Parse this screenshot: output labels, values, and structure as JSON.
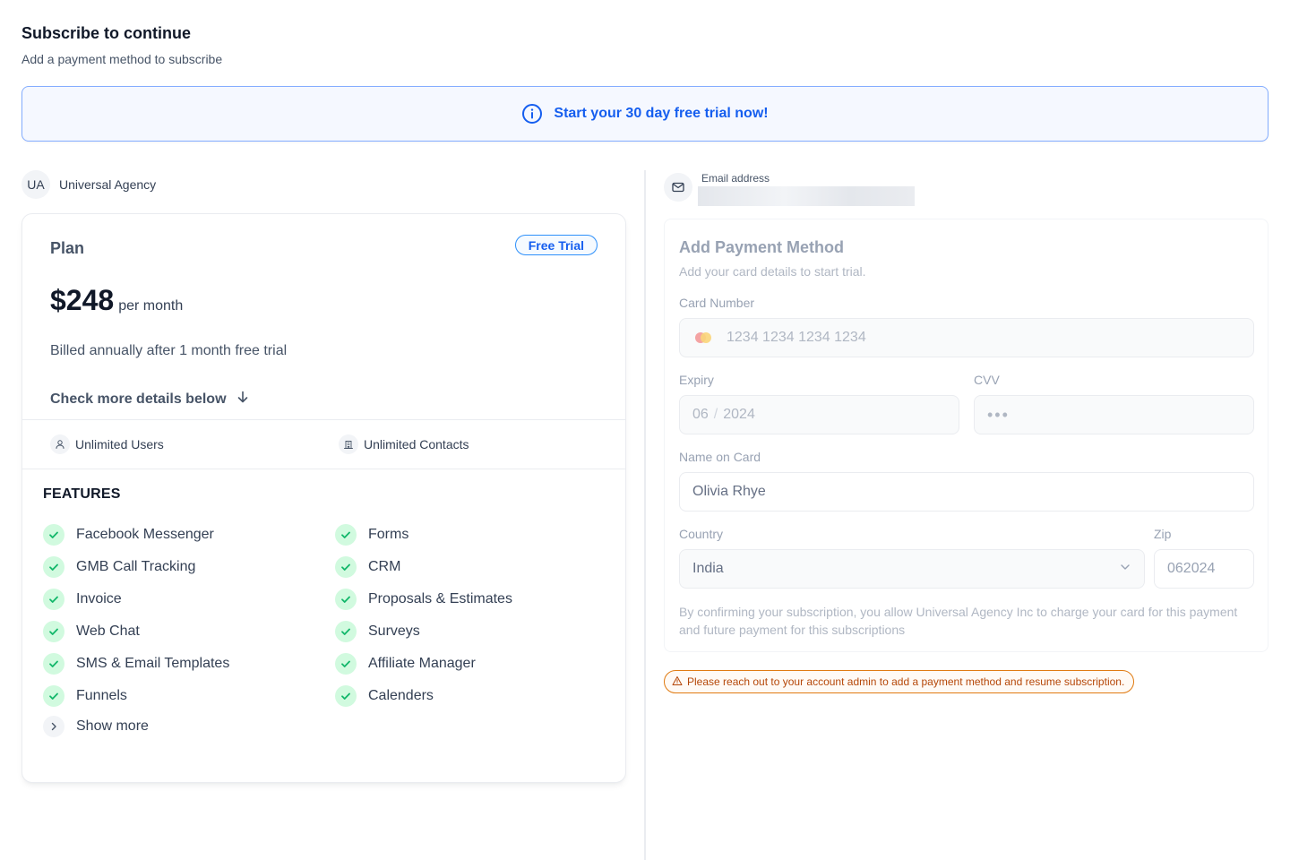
{
  "header": {
    "title": "Subscribe to continue",
    "subtitle": "Add a payment method to subscribe"
  },
  "banner": {
    "icon": "info-circle-icon",
    "text": "Start your 30 day free trial now!"
  },
  "agency": {
    "initials": "UA",
    "name": "Universal Agency"
  },
  "plan": {
    "title": "Plan",
    "badge": "Free Trial",
    "price": "$248",
    "period": "per month",
    "billing_note": "Billed annually after 1 month free trial",
    "details_link": "Check more details below",
    "limits": [
      {
        "icon": "user-icon",
        "label": "Unlimited Users"
      },
      {
        "icon": "building-icon",
        "label": "Unlimited Contacts"
      }
    ],
    "features_title": "FEATURES",
    "features_left": [
      "Facebook Messenger",
      "GMB Call Tracking",
      "Invoice",
      "Web Chat",
      "SMS & Email Templates",
      "Funnels"
    ],
    "features_right": [
      "Forms",
      "CRM",
      "Proposals & Estimates",
      "Surveys",
      "Affiliate Manager",
      "Calenders"
    ],
    "show_more": "Show more"
  },
  "email": {
    "label": "Email address",
    "icon": "mail-icon"
  },
  "payment": {
    "title": "Add Payment Method",
    "subtitle": "Add your card details to start trial.",
    "card_number_label": "Card Number",
    "card_number_placeholder": "1234 1234 1234 1234",
    "expiry_label": "Expiry",
    "expiry_month": "06",
    "expiry_sep": "/",
    "expiry_year": "2024",
    "cvv_label": "CVV",
    "cvv_placeholder": "•••",
    "name_label": "Name on Card",
    "name_value": "Olivia Rhye",
    "country_label": "Country",
    "country_value": "India",
    "zip_label": "Zip",
    "zip_value": "062024",
    "consent": "By confirming your subscription, you allow Universal Agency Inc to charge your card for this payment and future payment for this subscriptions"
  },
  "warning": {
    "icon": "warning-triangle-icon",
    "text": "Please reach out to your account admin to add a payment method and resume subscription."
  },
  "colors": {
    "accent": "#155eef",
    "check": "#12b76a",
    "warning": "#e07b12"
  }
}
